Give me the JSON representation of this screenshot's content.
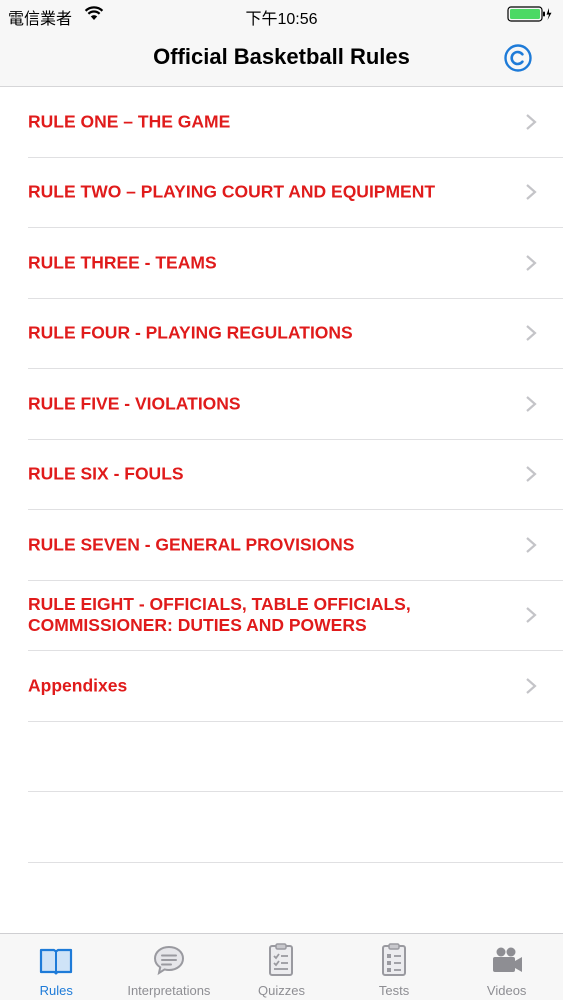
{
  "status_bar": {
    "carrier": "電信業者",
    "time": "下午10:56"
  },
  "nav": {
    "title": "Official Basketball Rules"
  },
  "rules": [
    {
      "label": "RULE ONE – THE GAME"
    },
    {
      "label": "RULE TWO – PLAYING COURT AND EQUIPMENT"
    },
    {
      "label": "RULE THREE - TEAMS"
    },
    {
      "label": "RULE FOUR - PLAYING REGULATIONS"
    },
    {
      "label": "RULE FIVE - VIOLATIONS"
    },
    {
      "label": "RULE SIX - FOULS"
    },
    {
      "label": "RULE SEVEN - GENERAL PROVISIONS"
    },
    {
      "label": "RULE EIGHT - OFFICIALS, TABLE OFFICIALS, COMMISSIONER: DUTIES AND POWERS"
    },
    {
      "label": "Appendixes"
    }
  ],
  "tabs": [
    {
      "label": "Rules",
      "icon": "book-icon",
      "active": true
    },
    {
      "label": "Interpretations",
      "icon": "speech-bubble-icon",
      "active": false
    },
    {
      "label": "Quizzes",
      "icon": "clipboard-check-icon",
      "active": false
    },
    {
      "label": "Tests",
      "icon": "clipboard-list-icon",
      "active": false
    },
    {
      "label": "Videos",
      "icon": "video-camera-icon",
      "active": false
    }
  ],
  "colors": {
    "accent": "#1e7bd8",
    "rule_text": "#e01b1b",
    "inactive_tab": "#8e8e93"
  }
}
